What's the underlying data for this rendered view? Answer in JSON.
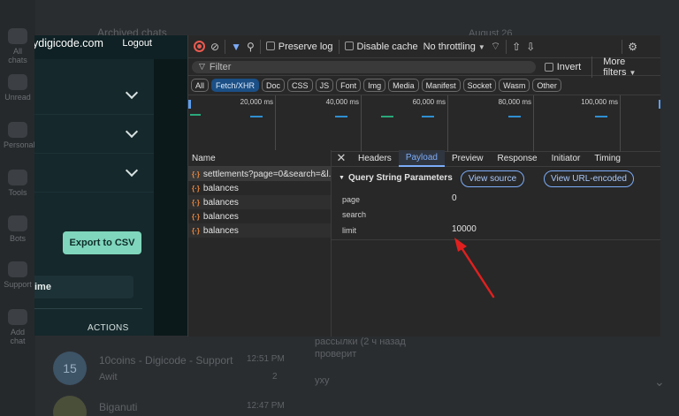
{
  "background": {
    "sidebar_labels": [
      "All chats",
      "Unread",
      "Personal",
      "Tools",
      "Bots",
      "Support",
      "Add chat"
    ],
    "top_text": "Archived chats",
    "top_date": "August 26",
    "chat_row_1": {
      "avatar": "15",
      "title": "10coins - Digicode - Support",
      "time": "12:51 PM",
      "preview": "Awit",
      "badge": "2"
    },
    "chat_row_2": {
      "title": "Biganuti",
      "time": "12:47 PM"
    },
    "right_text_1": "рассылки (2 ч назад",
    "right_text_2": "проверит",
    "right_text_3": "уху"
  },
  "site": {
    "domain": "ydigicode.com",
    "logout": "Logout",
    "export_label": "Export to CSV",
    "time_value": "ime",
    "actions_label": "ACTIONS"
  },
  "devtools": {
    "toolbar": {
      "preserve_log": "Preserve log",
      "disable_cache": "Disable cache",
      "throttling": "No throttling"
    },
    "filter_placeholder": "Filter",
    "invert_label": "Invert",
    "more_filters": "More filters",
    "types": [
      "All",
      "Fetch/XHR",
      "Doc",
      "CSS",
      "JS",
      "Font",
      "Img",
      "Media",
      "Manifest",
      "Socket",
      "Wasm",
      "Other"
    ],
    "active_type": "Fetch/XHR",
    "timeline_ticks": [
      "20,000 ms",
      "40,000 ms",
      "60,000 ms",
      "80,000 ms",
      "100,000 ms"
    ],
    "name_header": "Name",
    "requests": [
      "settlements?page=0&search=&l...",
      "balances",
      "balances",
      "balances",
      "balances"
    ],
    "detail_tabs": [
      "Headers",
      "Payload",
      "Preview",
      "Response",
      "Initiator",
      "Timing"
    ],
    "active_detail_tab": "Payload",
    "section_title": "Query String Parameters",
    "view_source": "View source",
    "view_url_encoded": "View URL-encoded",
    "params": [
      {
        "name": "page",
        "value": "0"
      },
      {
        "name": "search",
        "value": ""
      },
      {
        "name": "limit",
        "value": "10000"
      }
    ]
  },
  "annotation": {
    "arrow_color": "#e0201f"
  }
}
